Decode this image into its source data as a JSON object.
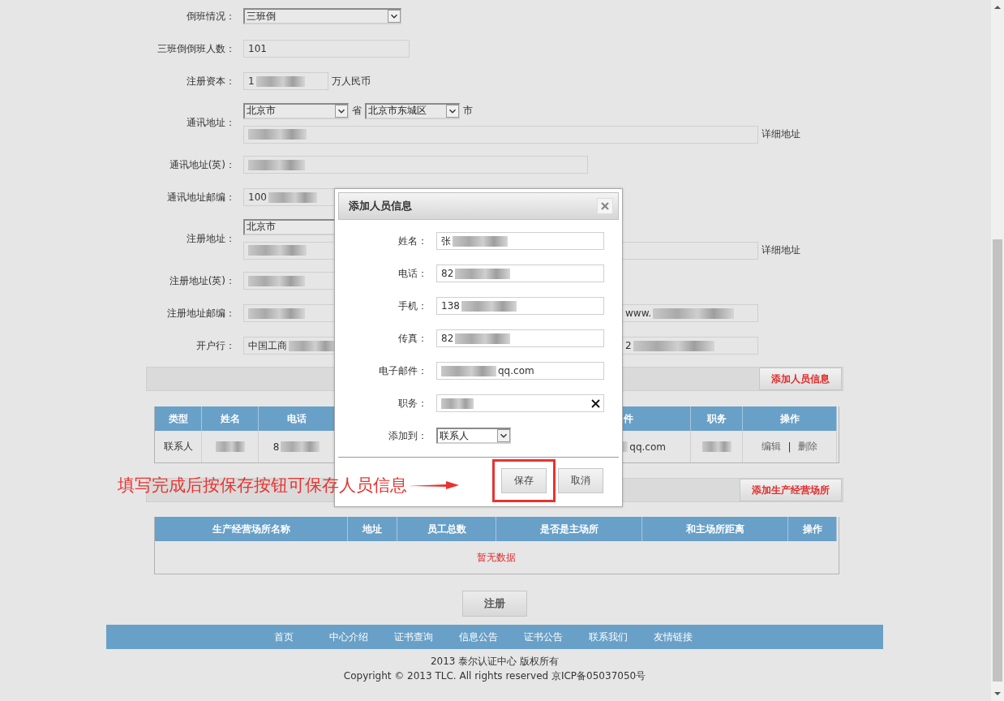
{
  "form": {
    "rows": [
      {
        "kind": "select",
        "label": "倒班情况：",
        "value": "三班倒"
      },
      {
        "kind": "text",
        "label": "三班倒倒班人数：",
        "value": "101"
      },
      {
        "kind": "text",
        "label": "注册资本：",
        "value": "1",
        "blur_after": true,
        "suffix": "万人民币"
      },
      {
        "kind": "address",
        "label": "通讯地址：",
        "province": "北京市",
        "province_suffix": "省",
        "city": "北京市东城区",
        "city_suffix": "市",
        "detail_blurred": true,
        "detail_suffix": "详细地址"
      },
      {
        "kind": "text",
        "label": "通讯地址(英)：",
        "blur_after": true
      },
      {
        "kind": "text",
        "label": "通讯地址邮编：",
        "value": "100",
        "blur_after": true
      },
      {
        "kind": "address",
        "label": "注册地址：",
        "province": "北京市",
        "detail_blurred": true,
        "detail_suffix": "详细地址"
      },
      {
        "kind": "text",
        "label": "注册地址(英)：",
        "blur_after": true
      },
      {
        "kind": "text",
        "label": "注册地址邮编：",
        "blur_after": true,
        "extra": {
          "value": "www.",
          "blur_after": true
        }
      },
      {
        "kind": "text",
        "label": "开户行：",
        "value": "中国工商",
        "blur_after": true,
        "extra": {
          "value": "2",
          "blur_after": true
        }
      }
    ]
  },
  "staff_bar": {
    "button": "添加人员信息"
  },
  "staff_table": {
    "columns": [
      "类型",
      "姓名",
      "电话",
      "件",
      "职务",
      "操作"
    ],
    "rows": [
      {
        "cells": [
          {
            "kind": "text",
            "text": "联系人"
          },
          {
            "kind": "text",
            "blur_after": true
          },
          {
            "kind": "text",
            "text": "8",
            "blur_after": true
          },
          {
            "kind": "text",
            "text": "qq.com",
            "blur_before": true
          },
          {
            "kind": "text",
            "blur_after": true
          },
          {
            "kind": "actions",
            "actions": [
              "编辑",
              "删除"
            ],
            "separator": "|"
          }
        ]
      }
    ]
  },
  "site_bar": {
    "button": "添加生产经营场所"
  },
  "site_table": {
    "columns": [
      "生产经营场所名称",
      "地址",
      "员工总数",
      "是否是主场所",
      "和主场所距离",
      "操作"
    ],
    "empty": "暂无数据"
  },
  "register_button": "注册",
  "footer": {
    "links": [
      "首页",
      "中心介绍",
      "证书查询",
      "信息公告",
      "证书公告",
      "联系我们",
      "友情链接"
    ],
    "lines": [
      "2013 泰尔认证中心 版权所有",
      "Copyright © 2013 TLC. All rights reserved 京ICP备05037050号"
    ]
  },
  "dialog": {
    "title": "添加人员信息",
    "fields": [
      {
        "kind": "input",
        "label": "姓名：",
        "value": "张",
        "blur_after": true
      },
      {
        "kind": "input",
        "label": "电话：",
        "value": "82",
        "blur_after": true
      },
      {
        "kind": "input",
        "label": "手机：",
        "value": "138",
        "blur_after": true
      },
      {
        "kind": "input",
        "label": "传真：",
        "value": "82",
        "blur_after": true
      },
      {
        "kind": "input",
        "label": "电子邮件：",
        "value": "qq.com",
        "blur_before": true
      },
      {
        "kind": "input",
        "label": "职务：",
        "blur_after": true,
        "clearable": true
      },
      {
        "kind": "select",
        "label": "添加到：",
        "value": "联系人"
      }
    ],
    "buttons": [
      {
        "label": "保存",
        "highlighted": true
      },
      {
        "label": "取消",
        "highlighted": false
      }
    ]
  },
  "annotation": {
    "text": "填写完成后按保存按钮可保存人员信息"
  }
}
